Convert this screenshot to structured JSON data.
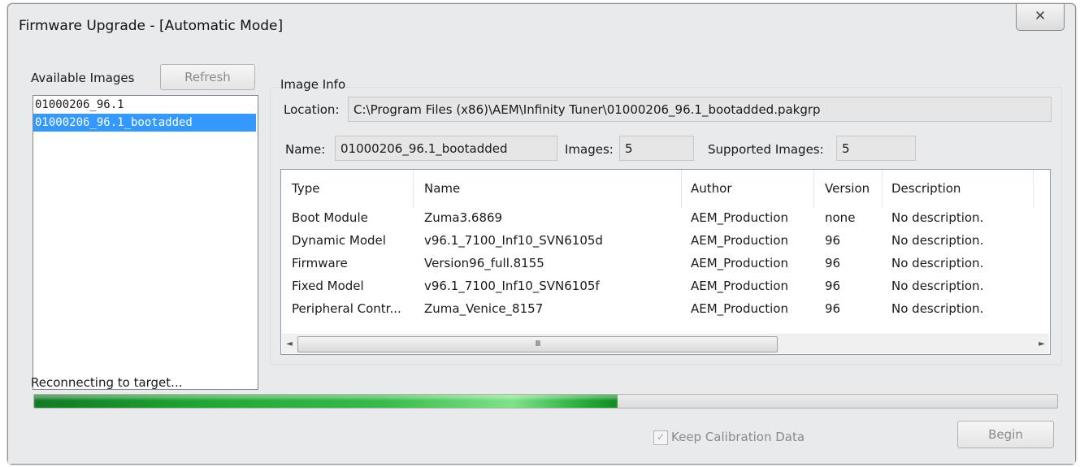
{
  "window": {
    "title": "Firmware Upgrade - [Automatic Mode]",
    "close_glyph": "✕"
  },
  "images_panel": {
    "label": "Available Images",
    "refresh_label": "Refresh",
    "items": [
      {
        "label": "01000206_96.1",
        "selected": false
      },
      {
        "label": "01000206_96.1_bootadded",
        "selected": true
      }
    ]
  },
  "image_info": {
    "group_label": "Image Info",
    "location_label": "Location:",
    "location_value": "C:\\Program Files (x86)\\AEM\\Infinity Tuner\\01000206_96.1_bootadded.pakgrp",
    "name_label": "Name:",
    "name_value": "01000206_96.1_bootadded",
    "images_label": "Images:",
    "images_value": "5",
    "supported_label": "Supported Images:",
    "supported_value": "5"
  },
  "table": {
    "columns": [
      "Type",
      "Name",
      "Author",
      "Version",
      "Description"
    ],
    "rows": [
      [
        "Boot Module",
        "Zuma3.6869",
        "AEM_Production",
        "none",
        "No description."
      ],
      [
        "Dynamic Model",
        "v96.1_7100_Inf10_SVN6105d",
        "AEM_Production",
        "96",
        "No description."
      ],
      [
        "Firmware",
        "Version96_full.8155",
        "AEM_Production",
        "96",
        "No description."
      ],
      [
        "Fixed Model",
        "v96.1_7100_Inf10_SVN6105f",
        "AEM_Production",
        "96",
        "No description."
      ],
      [
        "Peripheral Contr...",
        "Zuma_Venice_8157",
        "AEM_Production",
        "96",
        "No description."
      ]
    ],
    "scroll_left_glyph": "◄",
    "scroll_right_glyph": "►",
    "thumb_glyph": "III"
  },
  "status": {
    "text": "Reconnecting to target...",
    "progress": 0.57
  },
  "footer": {
    "keep_calibration_label": "Keep Calibration Data",
    "keep_calibration_checked": true,
    "check_glyph": "✓",
    "begin_label": "Begin"
  }
}
